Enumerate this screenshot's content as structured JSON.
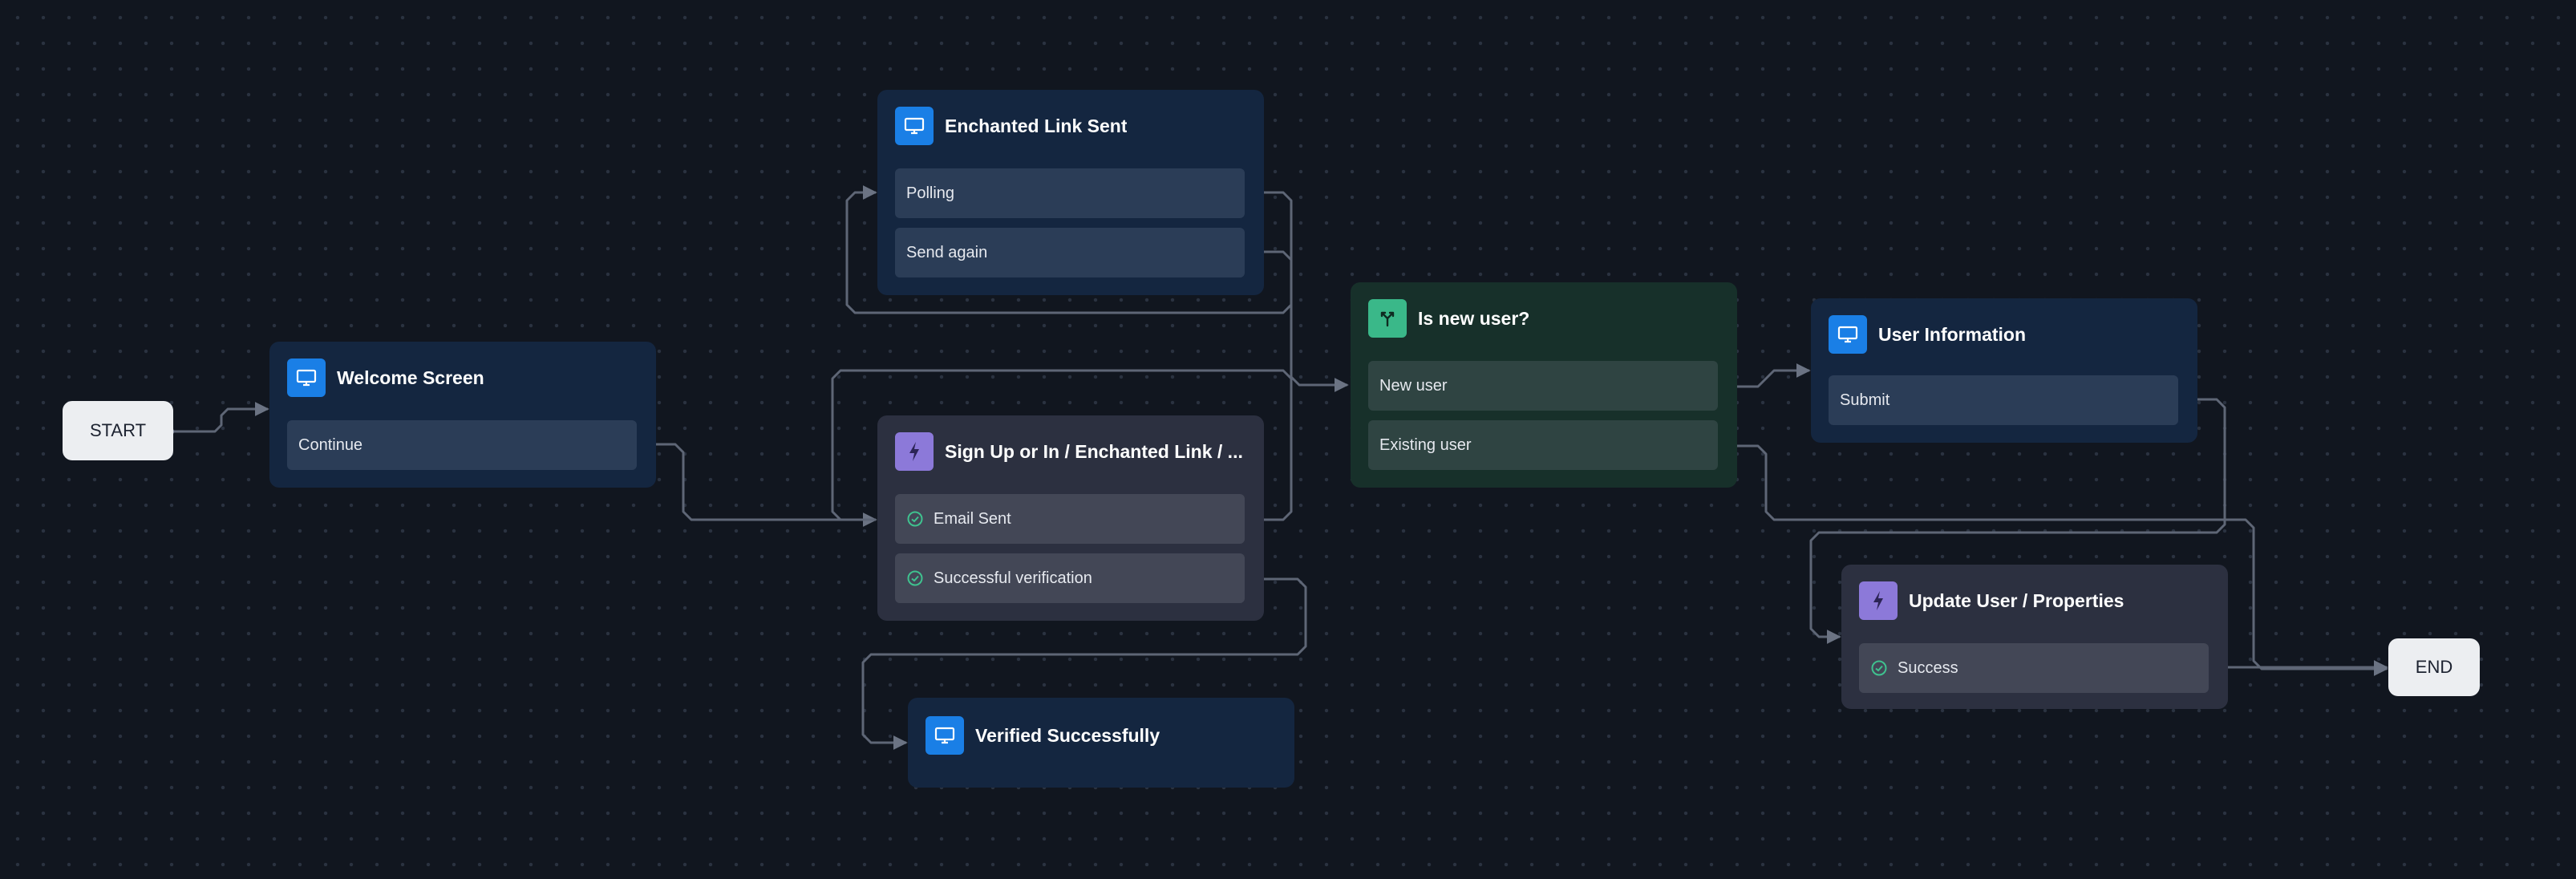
{
  "start": {
    "label": "START"
  },
  "end": {
    "label": "END"
  },
  "nodes": {
    "welcome": {
      "title": "Welcome Screen",
      "icon": "monitor-icon",
      "rows": [
        "Continue"
      ]
    },
    "enchanted_sent": {
      "title": "Enchanted Link Sent",
      "icon": "monitor-icon",
      "rows": [
        "Polling",
        "Send again"
      ]
    },
    "signup": {
      "title": "Sign Up or In / Enchanted Link / ...",
      "icon": "lightning-bolt-icon",
      "rows": [
        "Email Sent",
        "Successful verification"
      ]
    },
    "verified": {
      "title": "Verified Successfully",
      "icon": "monitor-icon"
    },
    "is_new_user": {
      "title": "Is new user?",
      "icon": "branch-icon",
      "rows": [
        "New user",
        "Existing user"
      ]
    },
    "user_info": {
      "title": "User Information",
      "icon": "monitor-icon",
      "rows": [
        "Submit"
      ]
    },
    "update_user": {
      "title": "Update User / Properties",
      "icon": "lightning-bolt-icon",
      "rows": [
        "Success"
      ]
    }
  },
  "colors": {
    "background": "#11161f",
    "screen_node": "#142640",
    "action_node": "#2c3040",
    "condition_node": "#17302a",
    "screen_icon": "#1a7fe6",
    "action_icon": "#8c79d9",
    "condition_icon": "#3ab889",
    "edge": "#6b7383"
  }
}
